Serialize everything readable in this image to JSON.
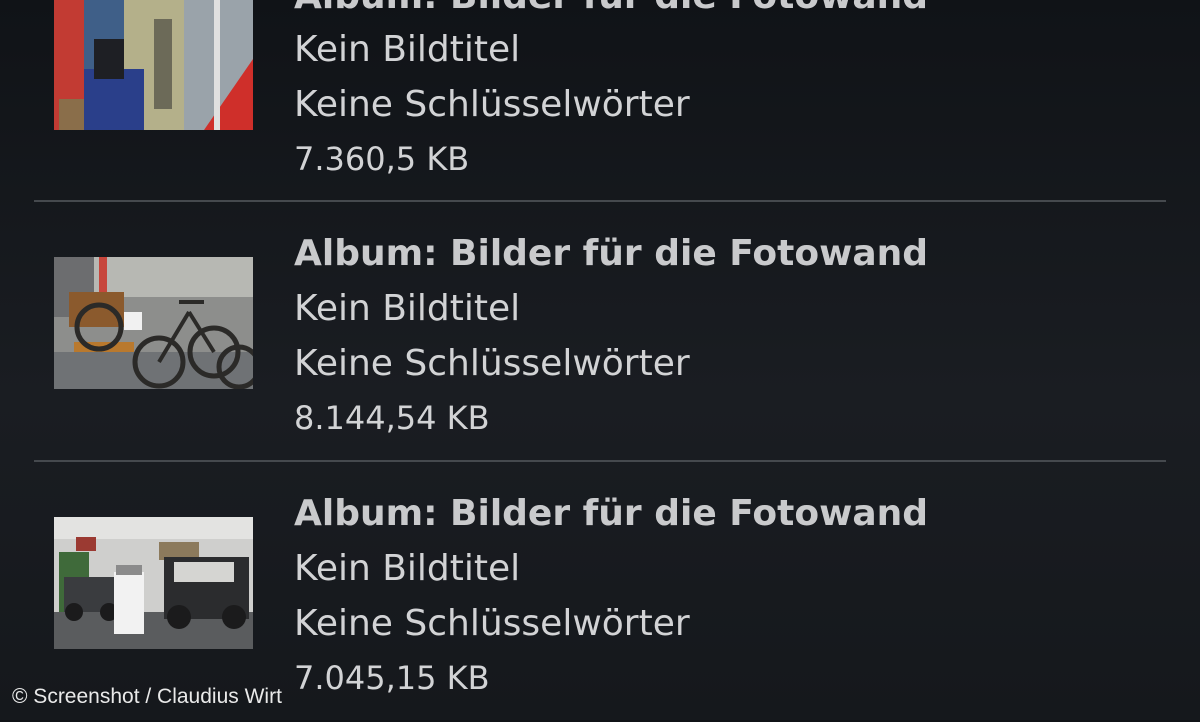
{
  "items": [
    {
      "album": "Album: Bilder für die Fotowand",
      "image_title": "Kein Bildtitel",
      "keywords": "Keine Schlüsselwörter",
      "size": "7.360,5 KB"
    },
    {
      "album": "Album: Bilder für die Fotowand",
      "image_title": "Kein Bildtitel",
      "keywords": "Keine Schlüsselwörter",
      "size": "8.144,54 KB"
    },
    {
      "album": "Album: Bilder für die Fotowand",
      "image_title": "Kein Bildtitel",
      "keywords": "Keine Schlüsselwörter",
      "size": "7.045,15 KB"
    }
  ],
  "credit": "© Screenshot / Claudius Wirt",
  "colors": {
    "background": "#15181c",
    "text": "#d2d3d5",
    "divider": "#45494e"
  }
}
